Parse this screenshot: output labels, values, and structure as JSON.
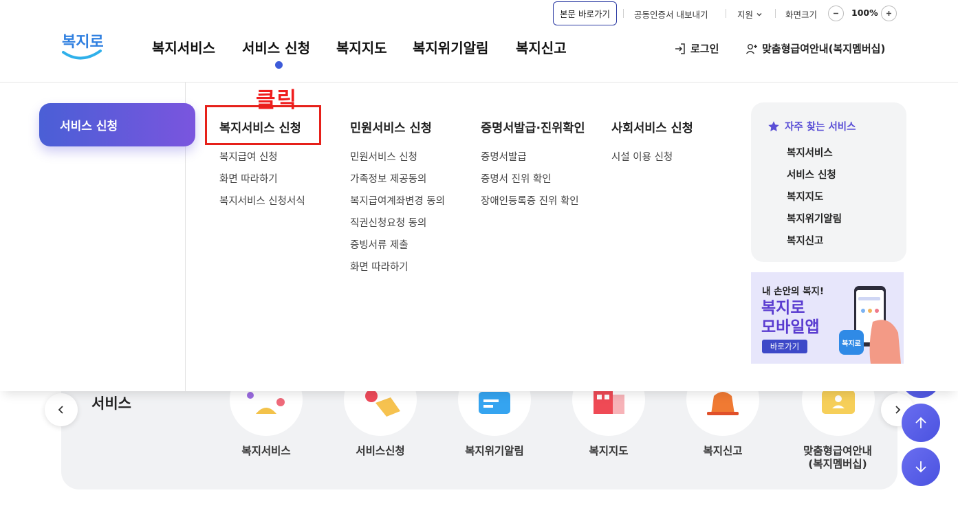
{
  "utility": {
    "skip_to_content": "본문 바로가기",
    "cert_export": "공동인증서 내보내기",
    "support": "지원",
    "zoom_label": "화면크기",
    "zoom_value": "100%"
  },
  "header": {
    "logo_text": "복지로",
    "nav": [
      "복지서비스",
      "서비스 신청",
      "복지지도",
      "복지위기알림",
      "복지신고"
    ],
    "active_nav_index": 1,
    "login": "로그인",
    "membership": "맞춤형급여안내(복지멤버십)"
  },
  "mega_menu": {
    "active_label": "서비스 신청",
    "annotation": "클릭",
    "columns": [
      {
        "title": "복지서비스 신청",
        "items": [
          "복지급여 신청",
          "화면 따라하기",
          "복지서비스 신청서식"
        ]
      },
      {
        "title": "민원서비스 신청",
        "items": [
          "민원서비스 신청",
          "가족정보 제공동의",
          "복지급여계좌변경 동의",
          "직권신청요청 동의",
          "증빙서류 제출",
          "화면 따라하기"
        ]
      },
      {
        "title": "증명서발급·진위확인",
        "items": [
          "증명서발급",
          "증명서 진위 확인",
          "장애인등록증 진위 확인"
        ]
      },
      {
        "title": "사회서비스 신청",
        "items": [
          "시설 이용 신청"
        ]
      }
    ],
    "favorites": {
      "title": "자주 찾는 서비스",
      "items": [
        "복지서비스",
        "서비스 신청",
        "복지지도",
        "복지위기알림",
        "복지신고"
      ]
    },
    "banner": {
      "line1": "내 손안의 복지!",
      "line2": "복지로",
      "line3": "모바일앱",
      "button": "바로가기",
      "app_icon_text": "복지로"
    }
  },
  "background": {
    "section_title": "서비스",
    "services": [
      "복지서비스",
      "서비스신청",
      "복지위기알림",
      "복지지도",
      "복지신고",
      "맞춤형급여안내\n(복지멤버십)"
    ]
  },
  "colors": {
    "accent": "#3d5bd9",
    "active_gradient_start": "#4a5fd6",
    "active_gradient_end": "#7a55de",
    "annotation_red": "#e6201a",
    "favorites_title": "#5a4fd6"
  }
}
